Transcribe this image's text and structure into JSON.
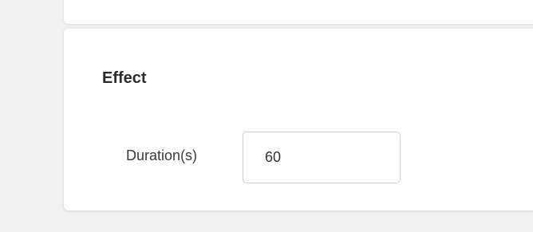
{
  "effect_section": {
    "title": "Effect",
    "duration_label": "Duration(s)",
    "duration_value": "60"
  }
}
